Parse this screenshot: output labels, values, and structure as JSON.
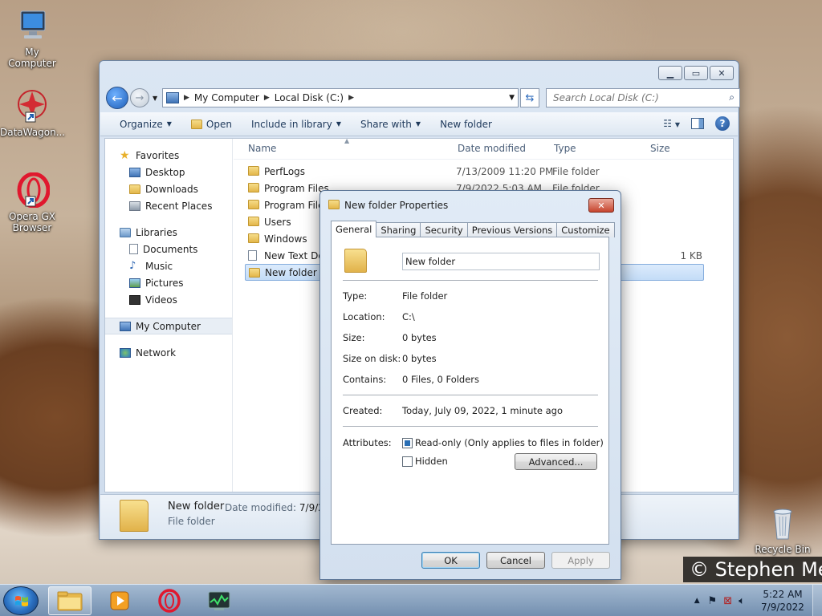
{
  "desktop": {
    "icons": [
      {
        "label": "My Computer"
      },
      {
        "label": "DataWagon..."
      },
      {
        "label": "Opera GX Browser"
      },
      {
        "label": "Recycle Bin"
      }
    ],
    "watermark": "© Stephen Me"
  },
  "explorer": {
    "breadcrumbs": [
      "My Computer",
      "Local Disk (C:)"
    ],
    "search_placeholder": "Search Local Disk (C:)",
    "toolbar": {
      "organize": "Organize",
      "open": "Open",
      "include_in_library": "Include in library",
      "share_with": "Share with",
      "new_folder": "New folder"
    },
    "nav": {
      "favorites": "Favorites",
      "favorites_items": [
        "Desktop",
        "Downloads",
        "Recent Places"
      ],
      "libraries": "Libraries",
      "libraries_items": [
        "Documents",
        "Music",
        "Pictures",
        "Videos"
      ],
      "my_computer": "My Computer",
      "network": "Network"
    },
    "columns": {
      "name": "Name",
      "date": "Date modified",
      "type": "Type",
      "size": "Size"
    },
    "files": [
      {
        "name": "PerfLogs",
        "date": "7/13/2009 11:20 PM",
        "type": "File folder",
        "size": ""
      },
      {
        "name": "Program Files",
        "date": "7/9/2022 5:03 AM",
        "type": "File folder",
        "size": ""
      },
      {
        "name": "Program Files",
        "date": "",
        "type": "",
        "size": ""
      },
      {
        "name": "Users",
        "date": "",
        "type": "",
        "size": ""
      },
      {
        "name": "Windows",
        "date": "",
        "type": "",
        "size": ""
      },
      {
        "name": "New Text Doc",
        "date": "",
        "type": "",
        "size": "1 KB"
      },
      {
        "name": "New folder",
        "date": "",
        "type": "",
        "size": ""
      }
    ],
    "details": {
      "name": "New folder",
      "type": "File folder",
      "date_label": "Date modified:",
      "date_value": "7/9/202"
    }
  },
  "dialog": {
    "title": "New folder Properties",
    "tabs": [
      "General",
      "Sharing",
      "Security",
      "Previous Versions",
      "Customize"
    ],
    "folder_name": "New folder",
    "props": {
      "type_label": "Type:",
      "type_value": "File folder",
      "location_label": "Location:",
      "location_value": "C:\\",
      "size_label": "Size:",
      "size_value": "0 bytes",
      "size_on_disk_label": "Size on disk:",
      "size_on_disk_value": "0 bytes",
      "contains_label": "Contains:",
      "contains_value": "0 Files, 0 Folders",
      "created_label": "Created:",
      "created_value": "Today, July 09, 2022, 1 minute ago",
      "attributes_label": "Attributes:",
      "readonly_label": "Read-only (Only applies to files in folder)",
      "hidden_label": "Hidden",
      "advanced_button": "Advanced..."
    },
    "buttons": {
      "ok": "OK",
      "cancel": "Cancel",
      "apply": "Apply"
    }
  },
  "taskbar": {
    "time": "5:22 AM",
    "date": "7/9/2022"
  }
}
